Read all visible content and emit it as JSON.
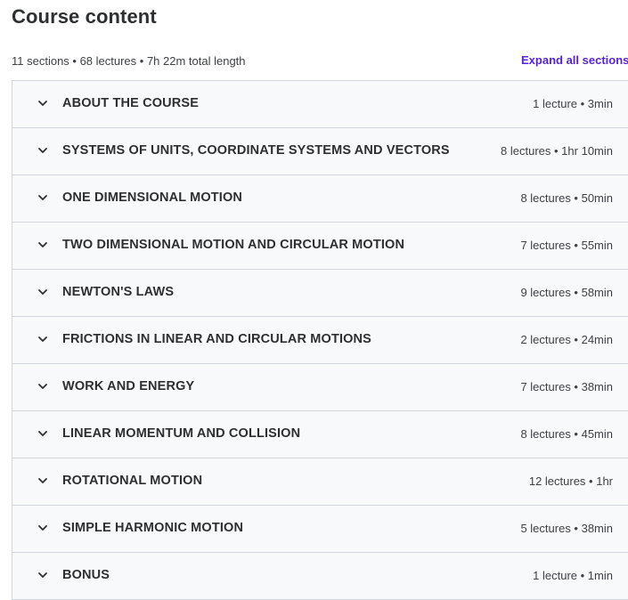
{
  "header": {
    "title": "Course content",
    "summary": "11 sections • 68 lectures • 7h 22m total length",
    "expand_all_label": "Expand all sections"
  },
  "sections": [
    {
      "title": "ABOUT THE COURSE",
      "meta": "1 lecture • 3min",
      "icon": "chevron-down-icon"
    },
    {
      "title": "SYSTEMS OF UNITS, COORDINATE SYSTEMS AND VECTORS",
      "meta": "8 lectures • 1hr 10min",
      "icon": "chevron-down-icon"
    },
    {
      "title": "ONE DIMENSIONAL MOTION",
      "meta": "8 lectures • 50min",
      "icon": "chevron-down-icon"
    },
    {
      "title": "TWO DIMENSIONAL MOTION AND CIRCULAR MOTION",
      "meta": "7 lectures • 55min",
      "icon": "chevron-down-icon"
    },
    {
      "title": "NEWTON'S LAWS",
      "meta": "9 lectures • 58min",
      "icon": "chevron-down-icon"
    },
    {
      "title": "FRICTIONS IN LINEAR AND CIRCULAR MOTIONS",
      "meta": "2 lectures • 24min",
      "icon": "chevron-down-icon"
    },
    {
      "title": "WORK AND ENERGY",
      "meta": "7 lectures • 38min",
      "icon": "chevron-down-icon"
    },
    {
      "title": "LINEAR MOMENTUM AND COLLISION",
      "meta": "8 lectures • 45min",
      "icon": "chevron-down-icon"
    },
    {
      "title": "ROTATIONAL MOTION",
      "meta": "12 lectures • 1hr",
      "icon": "chevron-down-icon"
    },
    {
      "title": "SIMPLE HARMONIC MOTION",
      "meta": "5 lectures • 38min",
      "icon": "chevron-down-icon"
    },
    {
      "title": "BONUS",
      "meta": "1 lecture • 1min",
      "icon": "chevron-down-icon"
    }
  ],
  "colors": {
    "accent": "#5624d0",
    "text": "#2d2f31",
    "section_bg": "#f7f9fa",
    "border": "#d1d7dc"
  }
}
